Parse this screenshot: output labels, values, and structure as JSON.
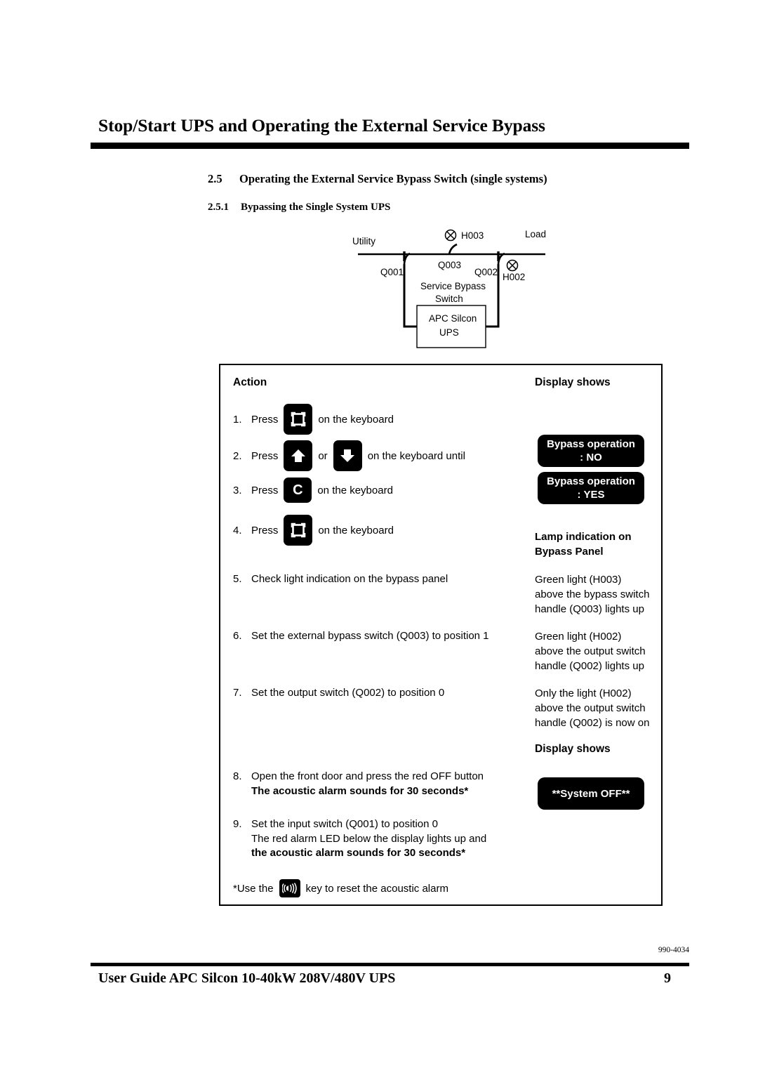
{
  "header": {
    "title": "Stop/Start UPS and Operating the External Service Bypass",
    "section_number": "2.5",
    "section_title": "Operating the External Service Bypass Switch (single systems)",
    "subsection_number": "2.5.1",
    "subsection_title": "Bypassing the Single System UPS"
  },
  "diagram": {
    "labels": {
      "utility": "Utility",
      "load": "Load",
      "h003": "H003",
      "h002": "H002",
      "q001": "Q001",
      "q002": "Q002",
      "q003": "Q003",
      "service_bypass_line1": "Service Bypass",
      "service_bypass_line2": "Switch",
      "ups_line1": "APC Silcon",
      "ups_line2": "UPS"
    }
  },
  "table": {
    "col_action_header": "Action",
    "col_display_header": "Display shows",
    "col_display_header_2": "Display shows",
    "lamp_header_line1": "Lamp indication on",
    "lamp_header_line2": "Bypass Panel",
    "steps": [
      {
        "num": "1.",
        "press_label": "Press",
        "key": "menu-key-icon",
        "tail": "on the keyboard"
      },
      {
        "num": "2.",
        "press_label": "Press",
        "key": "arrow-up-key-icon",
        "or_label": "or",
        "key2": "arrow-down-key-icon",
        "tail": "on the keyboard until"
      },
      {
        "num": "3.",
        "press_label": "Press",
        "key": "c-key-icon",
        "key_label": "C",
        "tail": "on the keyboard"
      },
      {
        "num": "4.",
        "press_label": "Press",
        "key": "menu-key-icon",
        "tail": "on the keyboard"
      },
      {
        "num": "5.",
        "text": "Check light indication on the bypass panel"
      },
      {
        "num": "6.",
        "text": "Set the external bypass switch (Q003) to position 1"
      },
      {
        "num": "7.",
        "text": "Set the output switch (Q002) to position 0"
      },
      {
        "num": "8.",
        "text": "Open the front door and press the red OFF button",
        "bold_line": "The acoustic alarm sounds for 30 seconds*"
      },
      {
        "num": "9.",
        "text": "Set the input switch (Q001) to position 0",
        "line2": "The red alarm LED below the display lights up and",
        "bold_line": "the acoustic alarm sounds for 30 seconds*"
      }
    ],
    "displays": [
      {
        "line1": "Bypass operation",
        "line2": ": NO"
      },
      {
        "line1": "Bypass operation",
        "line2": ": YES"
      },
      {
        "line1": "**System OFF**"
      }
    ],
    "results": [
      {
        "line1": "Green light (H003)",
        "line2": "above the bypass switch",
        "line3": "handle (Q003) lights up"
      },
      {
        "line1": "Green light (H002)",
        "line2": "above the output switch",
        "line3": "handle (Q002) lights up"
      },
      {
        "line1": "Only the light (H002)",
        "line2": "above the output switch",
        "line3": "handle (Q002) is now on"
      }
    ],
    "footnote": {
      "before": "*Use the",
      "key": "alarm-reset-key-icon",
      "after": "key  to reset the acoustic alarm"
    }
  },
  "footer": {
    "doc_code": "990-4034",
    "text": "User Guide APC Silcon 10-40kW 208V/480V UPS",
    "page": "9"
  }
}
